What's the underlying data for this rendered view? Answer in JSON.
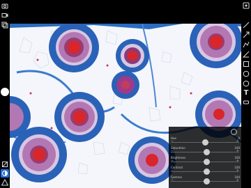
{
  "app": {
    "title": ""
  },
  "left_toolbar": {
    "items": [
      {
        "name": "camera-capture-icon"
      },
      {
        "name": "video-record-icon"
      },
      {
        "name": "layers-icon"
      },
      {
        "name": "shutter-button"
      },
      {
        "name": "crop-icon"
      },
      {
        "name": "adjust-icon"
      },
      {
        "name": "warning-icon"
      }
    ]
  },
  "right_toolbar": {
    "items": [
      {
        "name": "settings-icon"
      },
      {
        "name": "line-icon"
      },
      {
        "name": "arrow-icon"
      },
      {
        "name": "polyline-icon"
      },
      {
        "name": "angle-icon"
      },
      {
        "name": "rectangle-icon"
      },
      {
        "name": "circle-icon"
      },
      {
        "name": "ellipse-icon"
      },
      {
        "name": "text-icon"
      },
      {
        "name": "eraser-icon"
      }
    ],
    "text_tool_glyph": "T"
  },
  "adjust_panel": {
    "sliders": [
      {
        "label": "Hue",
        "value": "0",
        "level": 0.5
      },
      {
        "label": "Saturation",
        "value": "100",
        "level": 0.52
      },
      {
        "label": "Brightness",
        "value": "100",
        "level": 0.52
      },
      {
        "label": "Contrast",
        "value": "100",
        "level": 0.52
      },
      {
        "label": "Gamma",
        "value": "100",
        "level": 0.52
      }
    ]
  },
  "colors": {
    "stain_blue": "#1f5fb5",
    "stain_red": "#d42a25",
    "stain_purple": "#8a3a78",
    "background": "#ffffff"
  }
}
